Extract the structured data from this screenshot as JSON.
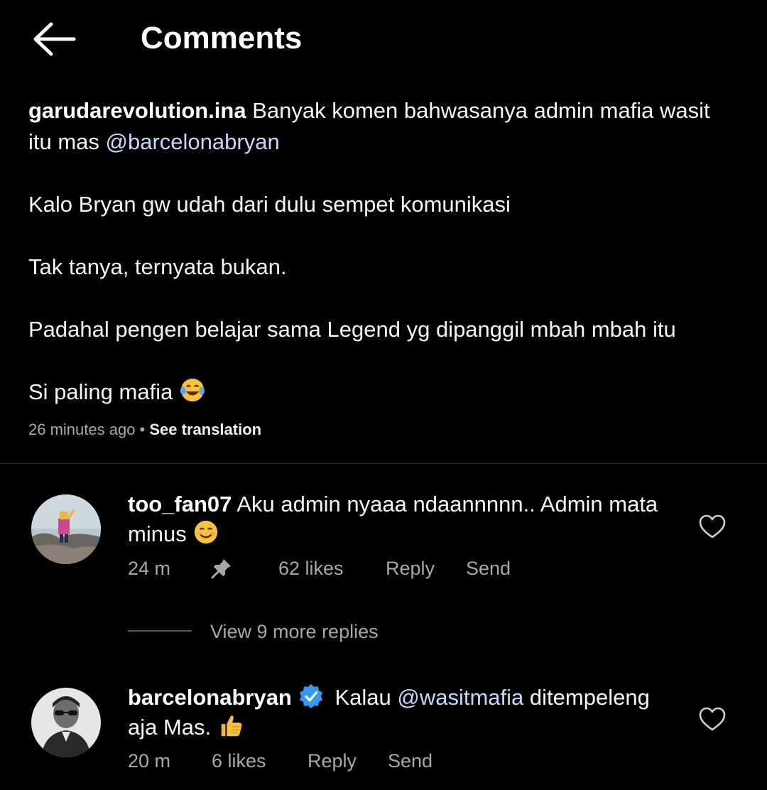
{
  "header": {
    "title": "Comments",
    "back_icon": "arrow-left-icon"
  },
  "caption": {
    "username": "garudarevolution.ina",
    "line1_text": " Banyak komen bahwasanya admin mafia wasit itu mas ",
    "line1_mention": "@barcelonabryan",
    "para2": "Kalo Bryan gw udah dari dulu sempet komunikasi",
    "para3": "Tak tanya, ternyata bukan.",
    "para4": "Padahal pengen belajar sama Legend yg dipanggil mbah mbah itu",
    "para5": "Si paling mafia ",
    "para5_emoji": "tears-of-joy-emoji",
    "time": "26 minutes ago",
    "separator": " • ",
    "see_translation": "See translation"
  },
  "comments": [
    {
      "username": "too_fan07",
      "text": " Aku admin nyaaa ndaannnnn.. Admin mata minus ",
      "emoji": "smiling-face-emoji",
      "time": "24 m",
      "pinned_icon": "pin-icon",
      "likes": "62 likes",
      "reply_label": "Reply",
      "send_label": "Send",
      "view_replies": "View 9 more replies"
    },
    {
      "username": "barcelonabryan",
      "verified_icon": "verified-badge-icon",
      "text_before": " Kalau ",
      "mention": "@wasitmafia",
      "text_after": " ditempeleng aja Mas. ",
      "emoji": "thumbs-up-emoji",
      "time": "20 m",
      "likes": "6 likes",
      "reply_label": "Reply",
      "send_label": "Send"
    }
  ],
  "colors": {
    "background": "#000000",
    "text": "#f5f5f5",
    "muted": "#a8a8a8",
    "mention": "#c9d7ff",
    "verified": "#3897f0"
  }
}
